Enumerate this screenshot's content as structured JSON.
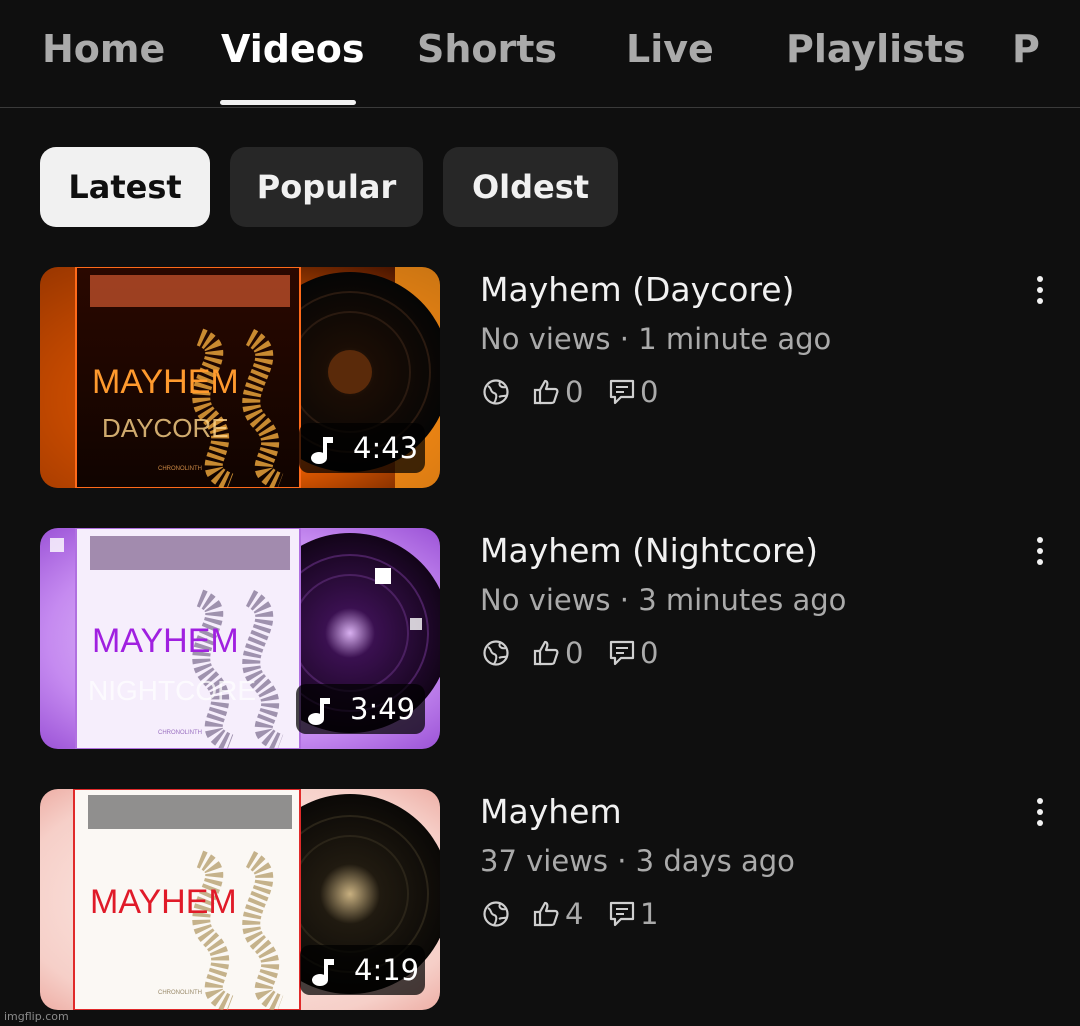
{
  "tabs": [
    "Home",
    "Videos",
    "Shorts",
    "Live",
    "Playlists",
    "Po"
  ],
  "active_tab": "Videos",
  "chips": [
    {
      "label": "Latest",
      "selected": true
    },
    {
      "label": "Popular",
      "selected": false
    },
    {
      "label": "Oldest",
      "selected": false
    }
  ],
  "videos": [
    {
      "title": "Mayhem (Daycore)",
      "meta": "No views · 1 minute ago",
      "duration": "4:43",
      "likes": "0",
      "comments": "0",
      "art_title": "MAYHEM",
      "art_subtitle": "DAYCORE",
      "art_artist": "CHRONOLINTH"
    },
    {
      "title": "Mayhem (Nightcore)",
      "meta": "No views · 3 minutes ago",
      "duration": "3:49",
      "likes": "0",
      "comments": "0",
      "art_title": "MAYHEM",
      "art_subtitle": "NIGHTCORE",
      "art_artist": "CHRONOLINTH"
    },
    {
      "title": "Mayhem",
      "meta": "37 views · 3 days ago",
      "duration": "4:19",
      "likes": "4",
      "comments": "1",
      "art_title": "MAYHEM",
      "art_artist": "CHRONOLINTH"
    }
  ],
  "icons": {
    "visibility": "globe-icon",
    "likes": "thumbs-up-icon",
    "comments": "comment-icon",
    "duration": "music-note-icon",
    "more": "more-vertical-icon"
  },
  "colors": {
    "background": "#0f0f0f",
    "chip_selected": "#f1f1f1",
    "chip": "#272727",
    "text_secondary": "#aaaaaa",
    "daycore_accent": "#ff8a1c",
    "nightcore_accent": "#a32be0",
    "original_accent": "#e11d2a"
  },
  "watermark": "imgflip.com"
}
